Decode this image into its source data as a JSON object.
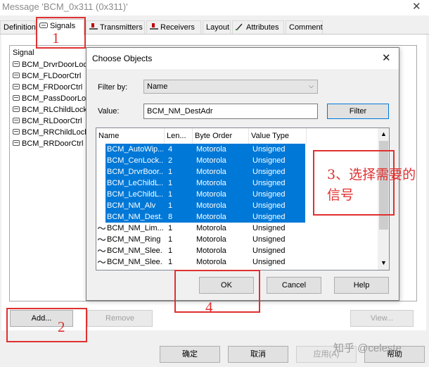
{
  "window": {
    "title": "Message 'BCM_0x311 (0x311)'",
    "close_glyph": "✕"
  },
  "tabs": [
    {
      "label": "Definition"
    },
    {
      "label": "Signals",
      "icon": "signals-tab-icon",
      "active": true
    },
    {
      "label": "Transmitters",
      "icon": "transmitter-icon"
    },
    {
      "label": "Receivers",
      "icon": "receiver-icon"
    },
    {
      "label": "Layout"
    },
    {
      "label": "Attributes",
      "icon": "attributes-icon"
    },
    {
      "label": "Comment"
    }
  ],
  "signal_list": {
    "header": "Signal",
    "items": [
      "BCM_DrvrDoorLoc",
      "BCM_FLDoorCtrl",
      "BCM_FRDoorCtrl",
      "BCM_PassDoorLo",
      "BCM_RLChildLock",
      "BCM_RLDoorCtrl",
      "BCM_RRChildLock",
      "BCM_RRDoorCtrl"
    ]
  },
  "panel_buttons": {
    "add": "Add...",
    "remove": "Remove",
    "view": "View..."
  },
  "dialog_buttons": {
    "ok": "确定",
    "cancel": "取消",
    "apply": "应用(A)",
    "help": "帮助"
  },
  "choose_dialog": {
    "title": "Choose Objects",
    "filter_by_label": "Filter by:",
    "filter_by_value": "Name",
    "value_label": "Value:",
    "value_text": "BCM_NM_DestAdr",
    "filter_button": "Filter",
    "columns": [
      "Name",
      "Len...",
      "Byte Order",
      "Value Type"
    ],
    "rows": [
      {
        "name": "BCM_AutoWip...",
        "len": "4",
        "order": "Motorola",
        "type": "Unsigned",
        "selected": true
      },
      {
        "name": "BCM_CenLock...",
        "len": "2",
        "order": "Motorola",
        "type": "Unsigned",
        "selected": true
      },
      {
        "name": "BCM_DrvrBoor...",
        "len": "1",
        "order": "Motorola",
        "type": "Unsigned",
        "selected": true
      },
      {
        "name": "BCM_LeChildL...",
        "len": "1",
        "order": "Motorola",
        "type": "Unsigned",
        "selected": true
      },
      {
        "name": "BCM_LeChildL...",
        "len": "1",
        "order": "Motorola",
        "type": "Unsigned",
        "selected": true
      },
      {
        "name": "BCM_NM_Alv",
        "len": "1",
        "order": "Motorola",
        "type": "Unsigned",
        "selected": true
      },
      {
        "name": "BCM_NM_Dest...",
        "len": "8",
        "order": "Motorola",
        "type": "Unsigned",
        "selected": true
      },
      {
        "name": "BCM_NM_Lim...",
        "len": "1",
        "order": "Motorola",
        "type": "Unsigned",
        "selected": false
      },
      {
        "name": "BCM_NM_Ring",
        "len": "1",
        "order": "Motorola",
        "type": "Unsigned",
        "selected": false
      },
      {
        "name": "BCM_NM_Slee...",
        "len": "1",
        "order": "Motorola",
        "type": "Unsigned",
        "selected": false
      },
      {
        "name": "BCM_NM_Slee...",
        "len": "1",
        "order": "Motorola",
        "type": "Unsigned",
        "selected": false
      }
    ],
    "ok": "OK",
    "cancel": "Cancel",
    "help": "Help"
  },
  "annotations": {
    "step1": "1",
    "step2": "2",
    "step3": "3、选择需要的信号",
    "step4": "4",
    "color": "#e03030"
  },
  "watermark": "知乎 @celeste",
  "colors": {
    "selection": "#0078d7",
    "background": "#f0f0f0"
  }
}
